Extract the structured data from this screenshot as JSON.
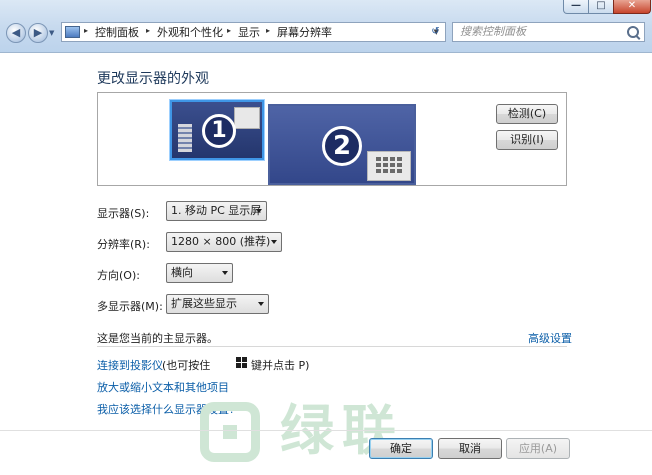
{
  "window": {
    "minimize_glyph": "—",
    "maximize_glyph": "□",
    "close_glyph": "✕"
  },
  "nav": {
    "back_glyph": "◀",
    "forward_glyph": "▶",
    "dropdown_glyph": "▼",
    "refresh_glyph": "↺"
  },
  "breadcrumb": {
    "items": [
      "控制面板",
      "外观和个性化",
      "显示",
      "屏幕分辨率"
    ],
    "separator": "▸"
  },
  "search": {
    "placeholder": "搜索控制面板"
  },
  "page": {
    "title": "更改显示器的外观"
  },
  "preview": {
    "monitor1_number": "1",
    "monitor2_number": "2",
    "detect_label": "检测(C)",
    "identify_label": "识别(I)",
    "selected_monitor": 1,
    "highlight_color": "#3f96e6"
  },
  "settings": {
    "display_label": "显示器(S):",
    "display_value": "1. 移动 PC 显示屏",
    "resolution_label": "分辨率(R):",
    "resolution_value": "1280 × 800 (推荐)",
    "orientation_label": "方向(O):",
    "orientation_value": "横向",
    "multi_label": "多显示器(M):",
    "multi_value": "扩展这些显示"
  },
  "info": {
    "primary_note": "这是您当前的主显示器。",
    "advanced_link": "高级设置"
  },
  "links": {
    "projector": "连接到投影仪",
    "projector_hint": "(也可按住",
    "projector_hint2": "键并点击 P)",
    "textsize": "放大或缩小文本和其他项目",
    "which": "我应该选择什么显示器设置?"
  },
  "watermark": {
    "text": "绿联"
  },
  "actions": {
    "ok": "确定",
    "cancel": "取消",
    "apply": "应用(A)"
  },
  "colors": {
    "link": "#0b5ea8",
    "title": "#1e395b"
  }
}
